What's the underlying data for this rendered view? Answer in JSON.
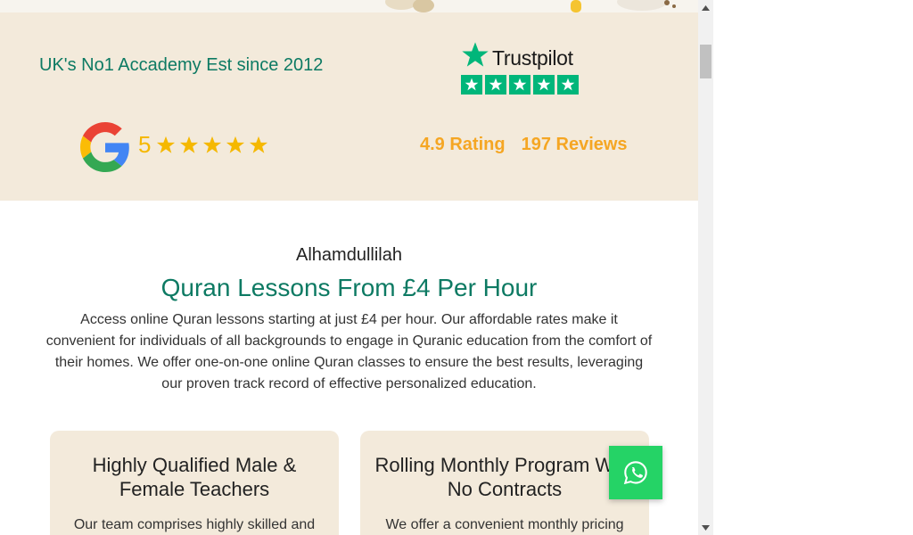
{
  "ratings": {
    "tagline": "UK's No1 Accademy Est since 2012",
    "trustpilot": {
      "name": "Trustpilot",
      "star_count": 5,
      "brand_color": "#00b67a"
    },
    "google": {
      "score": "5",
      "star_count": 5,
      "star_color": "#f5b800"
    },
    "rating_text": "4.9 Rating",
    "reviews_text": "197 Reviews"
  },
  "intro": {
    "eyebrow": "Alhamdullilah",
    "headline": "Quran Lessons From £4 Per Hour",
    "description": "Access online Quran lessons starting at just £4 per hour. Our affordable rates make it convenient for individuals of all backgrounds to engage in Quranic education from the comfort of their homes. We offer one-on-one online Quran classes to ensure the best results, leveraging our proven track record of effective personalized education."
  },
  "cards": [
    {
      "title": "Highly Qualified Male & Female Teachers",
      "text": "Our team comprises highly skilled and"
    },
    {
      "title": "Rolling Monthly Program With No Contracts",
      "text": "We offer a convenient monthly pricing"
    }
  ],
  "whatsapp": {
    "icon": "whatsapp-icon",
    "color": "#25d366"
  },
  "colors": {
    "accent": "#0d7a63",
    "band": "#f3eadb",
    "rating": "#f5a623"
  }
}
